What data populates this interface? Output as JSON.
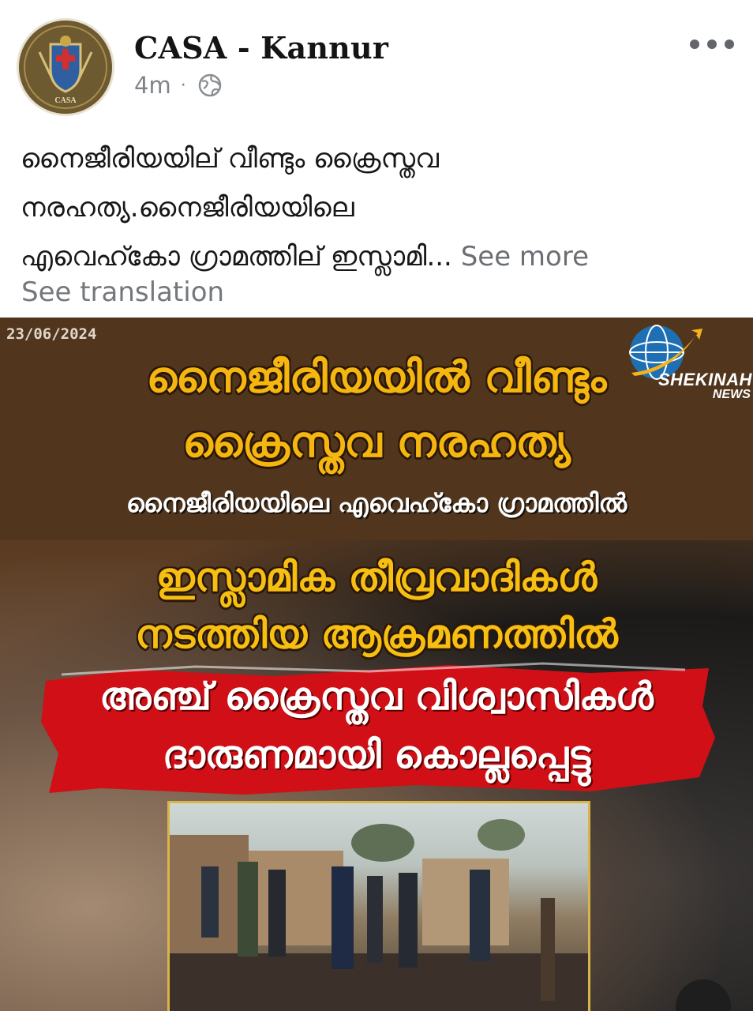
{
  "post": {
    "page_name": "CASA - Kannur",
    "time_ago": "4m",
    "separator": "·",
    "audience_icon": "globe-icon",
    "avatar_text": "CASA",
    "caption_line1": "നൈജീരിയയില് വീണ്ടും ക്രൈസ്തവ",
    "caption_line2": "നരഹത്യ.നൈജീരിയയിലെ",
    "caption_line3": "എവെഹ്കോ ഗ്രാമത്തില് ഇസ്ലാമി...",
    "see_more": "See more",
    "see_translation": "See translation"
  },
  "image": {
    "date": "23/06/2024",
    "logo_line1": "SHEKINAH",
    "logo_line2": "NEWS",
    "headline1": "നൈജീരിയയിൽ വീണ്ടും",
    "headline2": "ക്രൈസ്തവ നരഹത്യ",
    "subheadline": "നൈജീരിയയിലെ എവെഹ്കോ ഗ്രാമത്തിൽ",
    "headline3": "ഇസ്ലാമിക തീവ്രവാദികൾ",
    "headline4": "നടത്തിയ ആക്രമണത്തിൽ",
    "banner_line1": "അഞ്ച് ക്രൈസ്തവ വിശ്വാസികൾ",
    "banner_line2": "ദാരുണമായി കൊല്ലപ്പെട്ടു"
  },
  "colors": {
    "headline_yellow": "#f5b60f",
    "banner_red": "#d10f17",
    "top_band_brown": "#51361d",
    "muted_text": "#7f8388"
  }
}
